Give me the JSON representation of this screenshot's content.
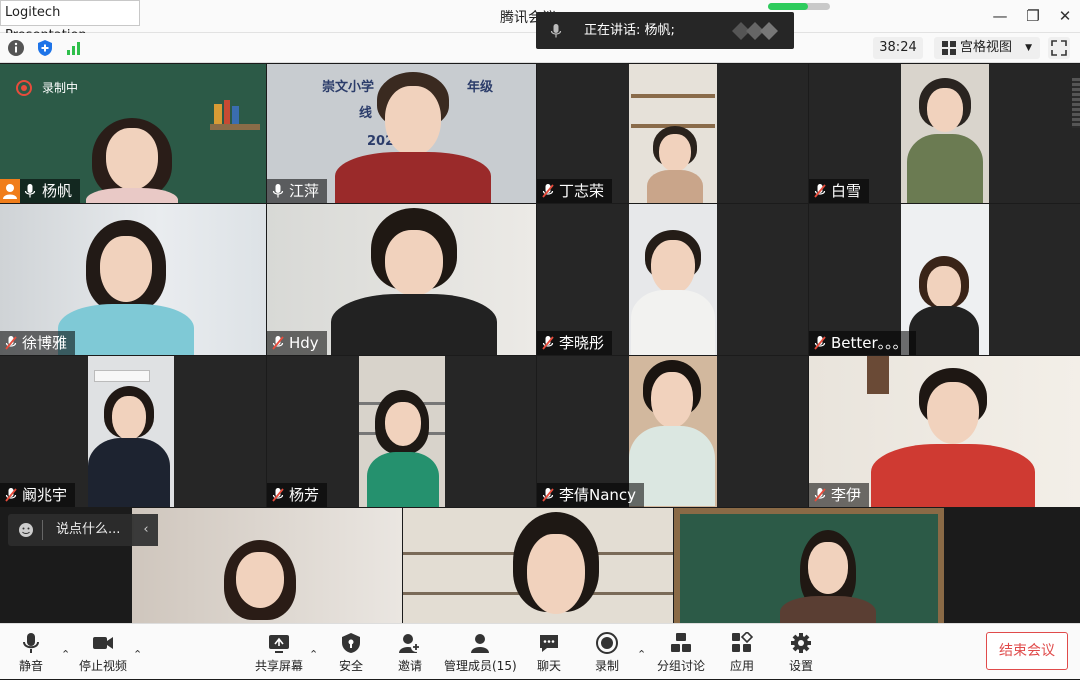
{
  "window": {
    "overlay_app": "Logitech Presentation",
    "title": "腾讯会议",
    "load_progress": 0.65
  },
  "toolbar": {
    "timer": "38:24",
    "view_mode": "宫格视图"
  },
  "speaking": {
    "text": "正在讲话: 杨帆;"
  },
  "recording": {
    "label": "录制中"
  },
  "participants": [
    {
      "name": "杨帆",
      "mic": "on",
      "host": true
    },
    {
      "name": "江萍",
      "mic": "on",
      "slide_title": "崇文小学",
      "slide_sub": "年级",
      "slide_date": "2022",
      "slide_line": "线"
    },
    {
      "name": "丁志荣",
      "mic": "muted"
    },
    {
      "name": "白雪",
      "mic": "muted"
    },
    {
      "name": "徐博雅",
      "mic": "muted"
    },
    {
      "name": "Hdy",
      "mic": "muted"
    },
    {
      "name": "李晓彤",
      "mic": "muted"
    },
    {
      "name": "Better。。。",
      "mic": "muted"
    },
    {
      "name": "阚兆宇",
      "mic": "muted"
    },
    {
      "name": "杨芳",
      "mic": "muted"
    },
    {
      "name": "李倩Nancy",
      "mic": "muted"
    },
    {
      "name": "李伊",
      "mic": "muted"
    }
  ],
  "chat": {
    "placeholder": "说点什么..."
  },
  "bottom_bar": {
    "mute": "静音",
    "stop_video": "停止视频",
    "share": "共享屏幕",
    "security": "安全",
    "invite": "邀请",
    "members": "管理成员(15)",
    "chat": "聊天",
    "record": "录制",
    "breakout": "分组讨论",
    "apps": "应用",
    "settings": "设置",
    "end_meeting": "结束会议"
  },
  "colors": {
    "end_red": "#e04b4b",
    "recording_red": "#e74c3c",
    "chalkboard_green": "#2c5a47",
    "shield_blue": "#1e74e8",
    "signal_green": "#2fbf4b"
  }
}
